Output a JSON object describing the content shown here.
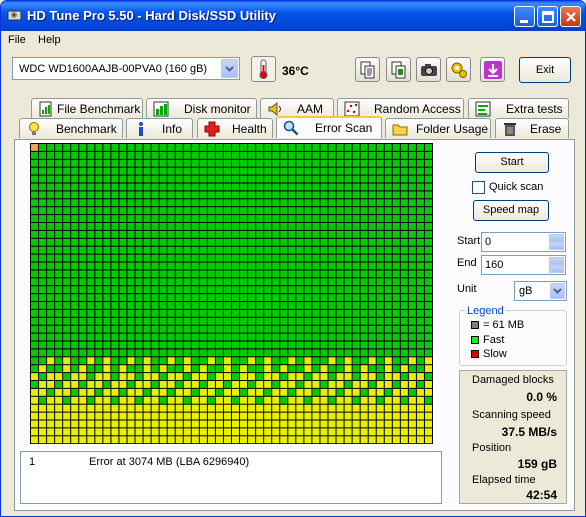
{
  "window": {
    "title": "HD Tune Pro 5.50 - Hard Disk/SSD Utility"
  },
  "menu": [
    "File",
    "Help"
  ],
  "toolbar": {
    "drive": "WDC WD1600AAJB-00PVA0 (160 gB)",
    "temperature": "36°C",
    "exit_label": "Exit",
    "icons": [
      "copy-text-icon",
      "copy-screenshot-icon",
      "camera-icon",
      "options-icon",
      "save-down-icon"
    ]
  },
  "tabs_top": [
    {
      "label": "File Benchmark",
      "icon": "file-benchmark-icon"
    },
    {
      "label": "Disk monitor",
      "icon": "disk-monitor-icon"
    },
    {
      "label": "AAM",
      "icon": "speaker-icon"
    },
    {
      "label": "Random Access",
      "icon": "random-access-icon"
    },
    {
      "label": "Extra tests",
      "icon": "extra-tests-icon"
    }
  ],
  "tabs_bottom": [
    {
      "label": "Benchmark",
      "icon": "bulb-icon"
    },
    {
      "label": "Info",
      "icon": "info-icon"
    },
    {
      "label": "Health",
      "icon": "health-cross-icon"
    },
    {
      "label": "Error Scan",
      "icon": "magnifier-icon",
      "active": true
    },
    {
      "label": "Folder Usage",
      "icon": "folder-icon"
    },
    {
      "label": "Erase",
      "icon": "trash-icon"
    }
  ],
  "scan": {
    "start_label": "Start",
    "quick_scan_label": "Quick scan",
    "quick_scan_checked": false,
    "speed_map_label": "Speed map",
    "start_field_label": "Start",
    "start_value": "0",
    "end_field_label": "End",
    "end_value": "160",
    "unit_label": "Unit",
    "unit_value": "gB"
  },
  "legend": {
    "title": "Legend",
    "items": [
      {
        "label": "= 61 MB",
        "color": "#808080"
      },
      {
        "label": "Fast",
        "color": "#00ff00"
      },
      {
        "label": "Slow",
        "color": "#e00000"
      }
    ]
  },
  "stats": {
    "damaged_label": "Damaged blocks",
    "damaged_value": "0.0 %",
    "speed_label": "Scanning speed",
    "speed_value": "37.5 MB/s",
    "position_label": "Position",
    "position_value": "159 gB",
    "elapsed_label": "Elapsed time",
    "elapsed_value": "42:54"
  },
  "log": [
    {
      "index": "1",
      "message": "Error at 3074 MB (LBA 6296940)"
    }
  ],
  "colors": {
    "fast_block": "#00cc00",
    "slower_block": "#e8f000",
    "error_block": "#f0a050",
    "grid_line": "#000000"
  }
}
